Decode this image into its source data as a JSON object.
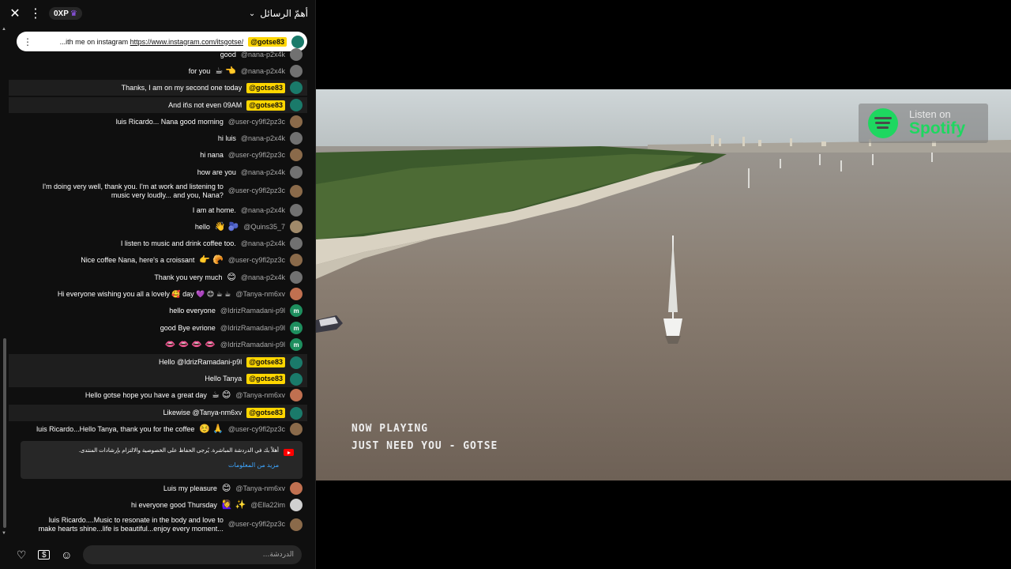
{
  "header": {
    "xp": "0XP",
    "top_chat_label": "أهمّ الرسائل"
  },
  "pinned": {
    "author": "@gotse83",
    "text_prefix": "...ith me on instagram ",
    "link": "https://www.instagram.com/itsgotse/"
  },
  "messages": [
    {
      "author": "@nana-p2x4k",
      "text": "good",
      "avatar_color": "#717171",
      "owner": false
    },
    {
      "author": "@nana-p2x4k",
      "text": "for you",
      "emoji": "☕ 👈",
      "avatar_color": "#717171",
      "owner": false
    },
    {
      "author": "@gotse83",
      "text": "Thanks, I am on my second one today",
      "avatar_color": "#1a7a6a",
      "owner": true
    },
    {
      "author": "@gotse83",
      "text": "And it\\s not even 09AM",
      "avatar_color": "#1a7a6a",
      "owner": true
    },
    {
      "author": "@user-cy9fl2pz3c",
      "text": "luis Ricardo... Nana good morning",
      "avatar_color": "#8a6a4a",
      "owner": false
    },
    {
      "author": "@nana-p2x4k",
      "text": "hi luis",
      "avatar_color": "#717171",
      "owner": false
    },
    {
      "author": "@user-cy9fl2pz3c",
      "text": "hi nana",
      "avatar_color": "#8a6a4a",
      "owner": false
    },
    {
      "author": "@nana-p2x4k",
      "text": "how are you",
      "avatar_color": "#717171",
      "owner": false
    },
    {
      "author": "@user-cy9fl2pz3c",
      "text": "I'm doing very well, thank you. I'm at work and listening to music very loudly... and you, Nana?",
      "avatar_color": "#8a6a4a",
      "owner": false
    },
    {
      "author": "@nana-p2x4k",
      "text": "I am at home.",
      "avatar_color": "#717171",
      "owner": false
    },
    {
      "author": "@Quins35_7",
      "text": "hello",
      "emoji": "👋 🫐",
      "avatar_color": "#a08a6a",
      "owner": false
    },
    {
      "author": "@nana-p2x4k",
      "text": "I listen to music and drink coffee too.",
      "avatar_color": "#717171",
      "owner": false
    },
    {
      "author": "@user-cy9fl2pz3c",
      "text": "Nice coffee Nana, here's a croissant",
      "emoji": "👉 🥐",
      "avatar_color": "#8a6a4a",
      "owner": false
    },
    {
      "author": "@nana-p2x4k",
      "text": "Thank you very much",
      "emoji": "😊",
      "avatar_color": "#717171",
      "owner": false
    },
    {
      "author": "@Tanya-nm6xv",
      "text": "Hi everyone wishing you all a lovely 🥰 day 💜 😊 ☕ ☕",
      "avatar_color": "#c07050",
      "owner": false
    },
    {
      "author": "@IdrizRamadani-p9l",
      "text": "hello everyone",
      "avatar_color": "#1e8e5e",
      "avatar_letter": "m",
      "owner": false
    },
    {
      "author": "@IdrizRamadani-p9l",
      "text": "good Bye evrione",
      "avatar_color": "#1e8e5e",
      "avatar_letter": "m",
      "owner": false
    },
    {
      "author": "@IdrizRamadani-p9l",
      "text": "",
      "emoji": "👄 👄 👄 👄",
      "avatar_color": "#1e8e5e",
      "avatar_letter": "m",
      "owner": false
    },
    {
      "author": "@gotse83",
      "text": "Hello @IdrizRamadani-p9l",
      "avatar_color": "#1a7a6a",
      "owner": true
    },
    {
      "author": "@gotse83",
      "text": "Hello Tanya",
      "avatar_color": "#1a7a6a",
      "owner": true
    },
    {
      "author": "@Tanya-nm6xv",
      "text": "Hello gotse hope you have a great day",
      "emoji": "☕ 😊",
      "avatar_color": "#c07050",
      "owner": false
    },
    {
      "author": "@gotse83",
      "text": "Likewise @Tanya-nm6xv",
      "avatar_color": "#1a7a6a",
      "owner": true
    },
    {
      "author": "@user-cy9fl2pz3c",
      "text": "luis Ricardo...Hello Tanya, thank you for the coffee",
      "emoji": "☺️ 🙏",
      "avatar_color": "#8a6a4a",
      "owner": false
    },
    {
      "author": "@Tanya-nm6xv",
      "text": "Luis my pleasure",
      "emoji": "😊",
      "avatar_color": "#c07050",
      "owner": false
    },
    {
      "author": "@Ella22im",
      "text": "hi everyone good Thursday",
      "emoji": "🙋‍♀️ ✨",
      "avatar_color": "#d0d0d0",
      "owner": false
    },
    {
      "author": "@user-cy9fl2pz3c",
      "text": "luis Ricardo....Music to resonate in the body and love to make hearts shine...life is beautiful...enjoy every moment...",
      "avatar_color": "#8a6a4a",
      "owner": false
    }
  ],
  "notice": {
    "text": "أهلاً بك في الدردشة المباشرة. يُرجى الحفاظ على الخصوصية والالتزام بإرشادات المنتدى.",
    "link": "مزيد من المعلومات"
  },
  "footer": {
    "input_placeholder": "الدردشة..."
  },
  "video": {
    "spotify_line1": "Listen on",
    "spotify_line2": "Spotify",
    "now_playing_label": "NOW PLAYING",
    "track": "JUST NEED YOU - GOTSE",
    "colors": {
      "spotify_green": "#1ed760",
      "owner_badge": "#ffd600",
      "link_blue": "#3ea6ff"
    }
  }
}
